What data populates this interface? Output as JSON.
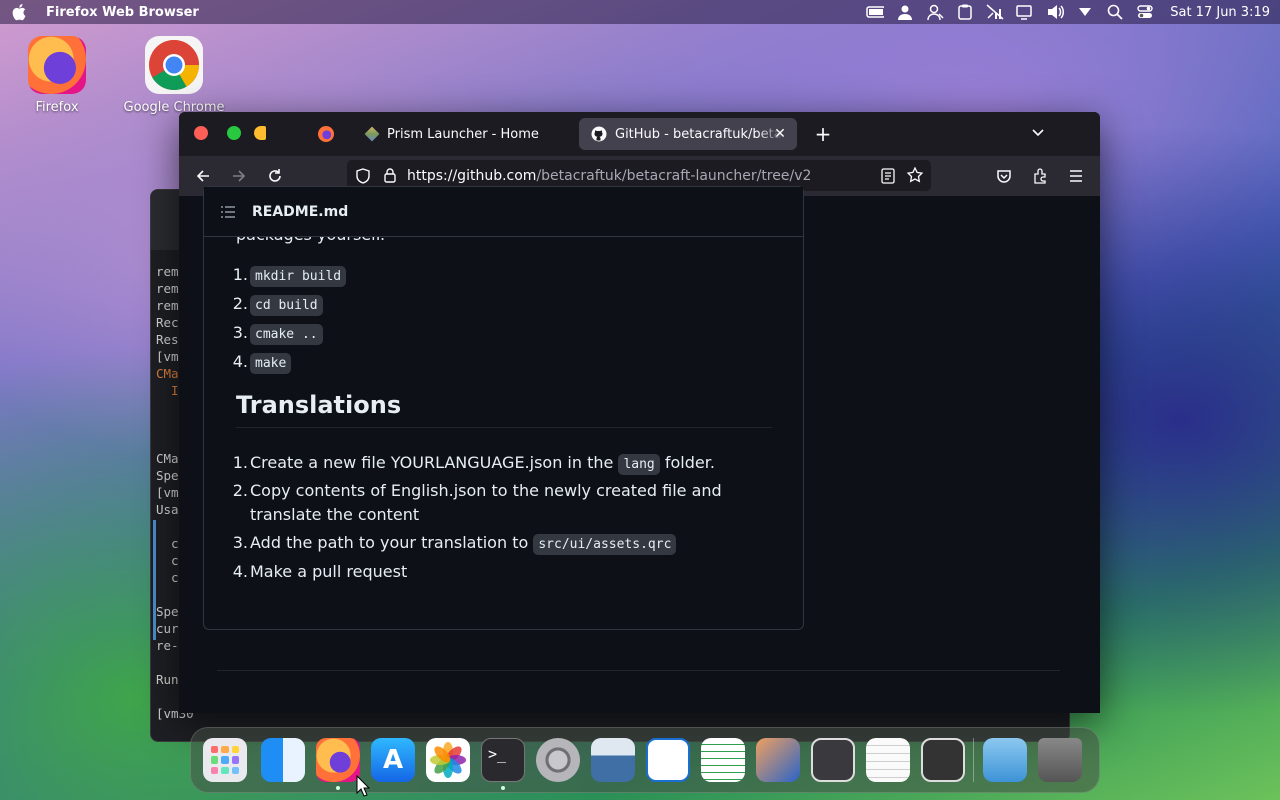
{
  "menubar": {
    "app_name": "Firefox Web Browser",
    "clock": "Sat 17 Jun  3:19",
    "icons": [
      "battery-icon",
      "user-icon",
      "accessibility-icon",
      "clipboard-icon",
      "network-off-icon",
      "display-icon",
      "volume-icon",
      "dropdown-icon",
      "search-icon",
      "control-center-icon"
    ]
  },
  "desktop": {
    "icons": [
      {
        "label": "Firefox"
      },
      {
        "label": "Google Chrome"
      }
    ]
  },
  "terminal": {
    "lines": [
      "rem",
      "rem",
      "rem",
      "Rec",
      "Res",
      "[vm",
      "CMa",
      "  I",
      "",
      "",
      "",
      "CMa",
      "Spe",
      "[vm",
      "Usa",
      "",
      "  c",
      "  c",
      "  c",
      "",
      "Spe",
      "cur",
      "re-",
      "",
      "Run",
      "",
      "[vm30  "
    ]
  },
  "browser": {
    "tabs": [
      {
        "label": "Prism Launcher - Home",
        "active": false
      },
      {
        "label": "GitHub - betacraftuk/betacraft-launcher",
        "active": true
      }
    ],
    "url_host": "https://github.com",
    "url_path": "/betacraftuk/betacraft-launcher/tree/v2"
  },
  "readme": {
    "filename": "README.md",
    "cut_text": "packages yourself.",
    "build_steps": [
      {
        "n": "1.",
        "code": "mkdir build"
      },
      {
        "n": "2.",
        "code": "cd build"
      },
      {
        "n": "3.",
        "code": "cmake .."
      },
      {
        "n": "4.",
        "code": "make"
      }
    ],
    "translations_heading": "Translations",
    "translation_steps": {
      "s1_pre": "Create a new file YOURLANGUAGE.json in the ",
      "s1_code": "lang",
      "s1_post": " folder.",
      "s2_line1": "Copy contents of English.json to the newly created file and",
      "s2_line2": "translate the content",
      "s3_pre": "Add the path to your translation to ",
      "s3_code": "src/ui/assets.qrc",
      "s4": "Make a pull request"
    }
  },
  "dock": {
    "items": [
      "launchpad",
      "finder",
      "firefox",
      "app-store",
      "photos",
      "terminal",
      "system-settings",
      "screenshot",
      "text-editor",
      "spreadsheet",
      "graphics-editor",
      "tape-recorder",
      "notes",
      "calculator",
      "downloads-folder",
      "trash"
    ]
  },
  "colors": {
    "accent": "#0060df",
    "page_bg": "#0d1117",
    "code_bg": "#343941"
  }
}
